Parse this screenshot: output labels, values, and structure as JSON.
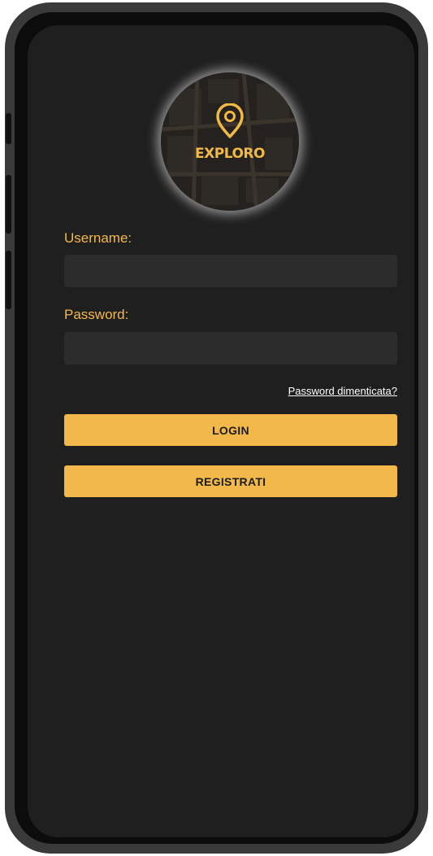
{
  "app": {
    "logo_text": "EXPLORO"
  },
  "form": {
    "username_label": "Username:",
    "username_value": "",
    "password_label": "Password:",
    "password_value": "",
    "forgot_link": "Password dimenticata?",
    "login_button": "LOGIN",
    "register_button": "REGISTRATI"
  },
  "colors": {
    "accent": "#f2b94a",
    "screen_background": "#1f1f1f",
    "input_background": "#2c2c2c"
  },
  "icons": {
    "logo": "map-pin-icon"
  }
}
